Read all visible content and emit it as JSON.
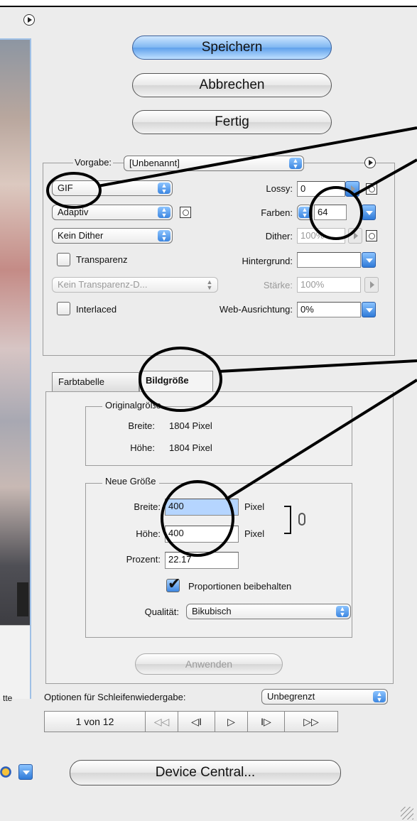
{
  "buttons": {
    "save": "Speichern",
    "cancel": "Abbrechen",
    "done": "Fertig",
    "apply": "Anwenden",
    "device_central": "Device Central..."
  },
  "settings": {
    "preset_label": "Vorgabe:",
    "preset_value": "[Unbenannt]",
    "format": "GIF",
    "reduction": "Adaptiv",
    "dither_algorithm": "Kein Dither",
    "lossy_label": "Lossy:",
    "lossy_value": "0",
    "colors_label": "Farben:",
    "colors_value": "64",
    "dither_label": "Dither:",
    "dither_value": "100%",
    "transparency_label": "Transparenz",
    "transparency_checked": false,
    "matte_label": "Hintergrund:",
    "matte_value": "",
    "transparency_dither": "Kein Transparenz-D...",
    "amount_label": "Stärke:",
    "amount_value": "100%",
    "interlaced_label": "Interlaced",
    "interlaced_checked": false,
    "web_snap_label": "Web-Ausrichtung:",
    "web_snap_value": "0%"
  },
  "tabs": {
    "color_table": "Farbtabelle",
    "image_size": "Bildgröße",
    "active": "Bildgröße"
  },
  "original_size": {
    "legend": "Originalgröße",
    "width_label": "Breite:",
    "width_value": "1804 Pixel",
    "height_label": "Höhe:",
    "height_value": "1804 Pixel"
  },
  "new_size": {
    "legend": "Neue Größe",
    "width_label": "Breite:",
    "width_value": "400",
    "width_unit": "Pixel",
    "height_label": "Höhe:",
    "height_value": "400",
    "height_unit": "Pixel",
    "percent_label": "Prozent:",
    "percent_value": "22.17",
    "constrain_label": "Proportionen beibehalten",
    "constrain_checked": true,
    "quality_label": "Qualität:",
    "quality_value": "Bikubisch"
  },
  "animation": {
    "loop_label": "Optionen für Schleifenwiedergabe:",
    "loop_value": "Unbegrenzt",
    "frame_counter": "1 von 12",
    "first_glyph": "◁◁",
    "prev_glyph": "◁I",
    "play_glyph": "▷",
    "next_glyph": "I▷",
    "last_glyph": "▷▷"
  },
  "preview_panel": {
    "cut_label": "tte"
  },
  "colors": {
    "accent": "#3d86e0",
    "annotation": "#000000"
  }
}
